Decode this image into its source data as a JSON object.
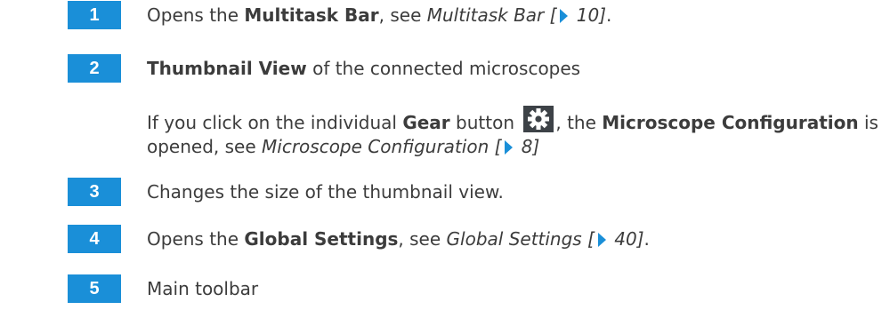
{
  "items": [
    {
      "num": "1",
      "pre": "Opens the ",
      "bold": "Multitask Bar",
      "mid": ", see ",
      "ref": "Multitask Bar [",
      "page": " 10]",
      "post": "."
    },
    {
      "num": "2",
      "bold": "Thumbnail View",
      "post": " of the connected microscopes",
      "para": {
        "pre": "If you click on the individual ",
        "bold1": "Gear",
        "mid1": " button ",
        "mid2": ", the ",
        "bold2": "Microscope Configuration",
        "post": " is",
        "line2_pre": "opened, see ",
        "ref": "Microscope Configuration [",
        "page": " 8]"
      }
    },
    {
      "num": "3",
      "text": "Changes the size of the thumbnail view."
    },
    {
      "num": "4",
      "pre": "Opens the ",
      "bold": "Global Settings",
      "mid": ", see ",
      "ref": "Global Settings [",
      "page": " 40]",
      "post": "."
    },
    {
      "num": "5",
      "text": "Main toolbar"
    }
  ],
  "colors": {
    "badge": "#1a8fd8",
    "text": "#3c3c3c",
    "gear_bg": "#3d4247",
    "gear": "#ffffff"
  },
  "icons": [
    "gear-icon",
    "page-arrow-icon"
  ]
}
